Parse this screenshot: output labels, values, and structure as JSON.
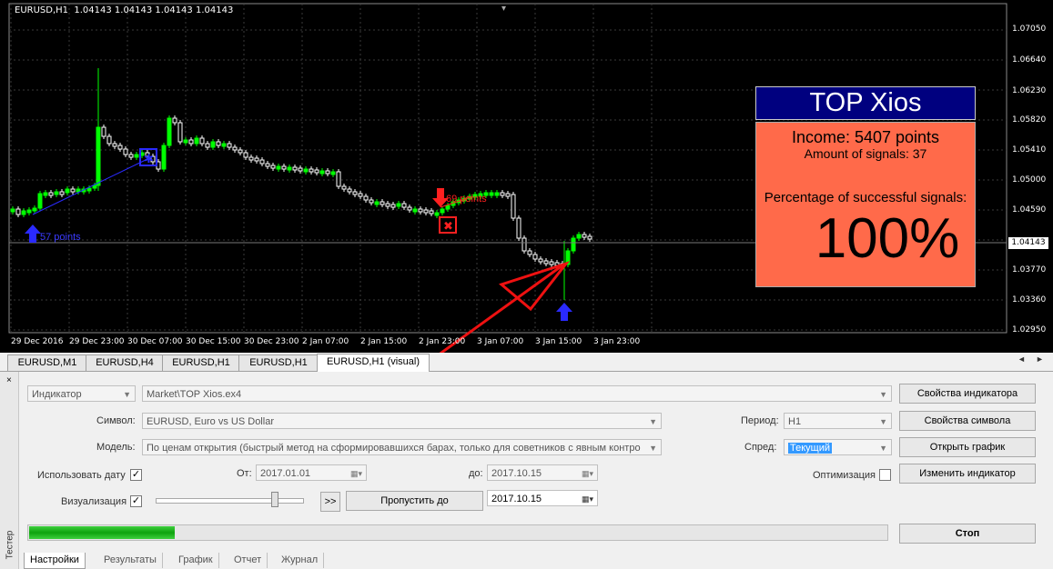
{
  "chart": {
    "header": "EURUSD,H1  1.04143 1.04143 1.04143 1.04143",
    "current_price": "1.04143",
    "price_labels": [
      "1.07050",
      "1.06640",
      "1.06230",
      "1.05820",
      "1.05410",
      "1.05000",
      "1.04590",
      "1.04143",
      "1.03770",
      "1.03360",
      "1.02950"
    ],
    "time_labels": [
      "29 Dec 2016",
      "29 Dec 23:00",
      "30 Dec 07:00",
      "30 Dec 15:00",
      "30 Dec 23:00",
      "2 Jan 07:00",
      "2 Jan 15:00",
      "2 Jan 23:00",
      "3 Jan 07:00",
      "3 Jan 15:00",
      "3 Jan 23:00"
    ],
    "signal_buy_text": "57 points",
    "signal_sell_text": "69 points",
    "colors": {
      "background": "#000000",
      "bull": "#00ff00",
      "bear": "#ffffff",
      "grid": "#3a3a3a",
      "buy_arrow": "#2a2aff",
      "sell_arrow": "#ff2020"
    }
  },
  "indicator": {
    "title": "TOP Xios",
    "income": "Income: 5407 points",
    "amount": "Amount of signals: 37",
    "percentage_label": "Percentage of successful signals:",
    "percentage_value": "100%"
  },
  "chart_tabs": [
    "EURUSD,M1",
    "EURUSD,H4",
    "EURUSD,H1",
    "EURUSD,H1",
    "EURUSD,H1 (visual)"
  ],
  "tester": {
    "type_select": "Индикатор",
    "expert_path": "Market\\TOP Xios.ex4",
    "symbol_label": "Символ:",
    "symbol_value": "EURUSD, Euro vs US Dollar",
    "model_label": "Модель:",
    "model_value": "По ценам открытия (быстрый метод на сформировавшихся барах, только для советников с явным контро",
    "use_date_label": "Использовать дату",
    "from_label": "От:",
    "from_value": "2017.01.01",
    "to_label": "до:",
    "to_value": "2017.10.15",
    "visual_label": "Визуализация",
    "skip_to_label": "Пропустить до",
    "skip_to_value": "2017.10.15",
    "forward_label": ">>",
    "period_label": "Период:",
    "period_value": "H1",
    "spread_label": "Спред:",
    "spread_value": "Текущий",
    "optimization_label": "Оптимизация",
    "btn_indicator_props": "Свойства индикатора",
    "btn_symbol_props": "Свойства символа",
    "btn_open_chart": "Открыть график",
    "btn_modify_indicator": "Изменить индикатор",
    "btn_stop": "Стоп",
    "progress": 0.17,
    "side_label": "Тестер",
    "close_glyph": "×"
  },
  "bottom_tabs": [
    "Настройки",
    "Результаты",
    "График",
    "Отчет",
    "Журнал"
  ]
}
